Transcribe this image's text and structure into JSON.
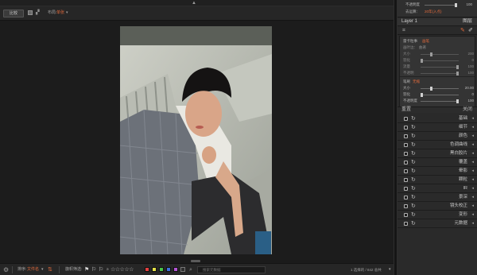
{
  "toolbar": {
    "compare_label": "比较",
    "layout_label": "布局:",
    "layout_value": "单张",
    "caret": "▾"
  },
  "panel": {
    "opacity_label": "不透明度",
    "opacity_value": "100",
    "blend_label": "去运算：",
    "blend_value": "20年(入点)",
    "layer_name": "Layer 1",
    "layer_right": "图层",
    "brush_mode_label": "雷卡粒事",
    "brush_mode_value": "画笔",
    "sub_label": "画叶边：",
    "sub_value": "曲著",
    "rows_a": [
      {
        "label": "大小",
        "value": "200"
      },
      {
        "label": "羽化",
        "value": "0"
      },
      {
        "label": "流量",
        "value": "100"
      },
      {
        "label": "不透明",
        "value": "100"
      }
    ],
    "brush2_label": "笔刷",
    "brush2_value": "无缩",
    "rows_b": [
      {
        "label": "大小",
        "value": "20.00"
      },
      {
        "label": "羽化",
        "value": "0"
      },
      {
        "label": "不透明度",
        "value": "100"
      }
    ],
    "bottom_left": "重置",
    "bottom_right": "关闭"
  },
  "modules": [
    {
      "name": "基础"
    },
    {
      "name": "细节"
    },
    {
      "name": "颜色"
    },
    {
      "name": "色调曲线"
    },
    {
      "name": "黑白胶片"
    },
    {
      "name": "覆盖"
    },
    {
      "name": "晕影"
    },
    {
      "name": "颗粒"
    },
    {
      "name": "IR"
    },
    {
      "name": "景深"
    },
    {
      "name": "镜头校正"
    },
    {
      "name": "变形"
    },
    {
      "name": "元数据"
    }
  ],
  "bottombar": {
    "sort_label": "排序:",
    "sort_value": "文件名",
    "filter_label": "旗帜筛选:",
    "stars": "☆☆☆☆☆",
    "search_placeholder": "搜索元数据",
    "status": "1 选择的 / 842 总共"
  },
  "colors": {
    "accent": "#e06a3c",
    "labels": [
      "#e43f3f",
      "#e6e247",
      "#48c44a",
      "#3c6fe0",
      "#b455d6"
    ]
  }
}
